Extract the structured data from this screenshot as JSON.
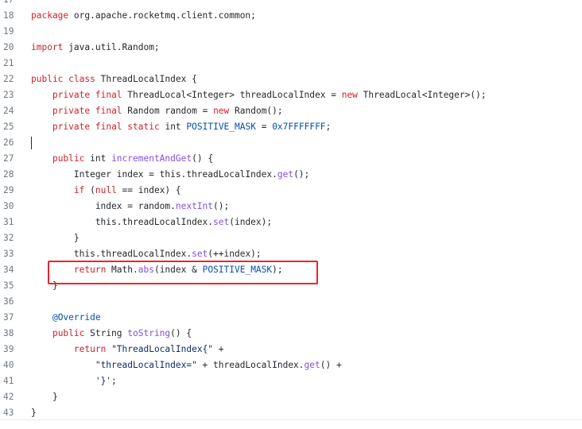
{
  "lines": [
    {
      "num": "17",
      "tokens": []
    },
    {
      "num": "18",
      "tokens": [
        {
          "c": "kw",
          "t": "package"
        },
        {
          "c": "t",
          "t": " org.apache.rocketmq.client.common;"
        }
      ]
    },
    {
      "num": "19",
      "tokens": []
    },
    {
      "num": "20",
      "tokens": [
        {
          "c": "kw",
          "t": "import"
        },
        {
          "c": "t",
          "t": " java.util.Random;"
        }
      ]
    },
    {
      "num": "21",
      "tokens": []
    },
    {
      "num": "22",
      "tokens": [
        {
          "c": "kw",
          "t": "public"
        },
        {
          "c": "t",
          "t": " "
        },
        {
          "c": "kw",
          "t": "class"
        },
        {
          "c": "t",
          "t": " ThreadLocalIndex {"
        }
      ]
    },
    {
      "num": "23",
      "tokens": [
        {
          "c": "t",
          "t": "    "
        },
        {
          "c": "kw",
          "t": "private"
        },
        {
          "c": "t",
          "t": " "
        },
        {
          "c": "kw",
          "t": "final"
        },
        {
          "c": "t",
          "t": " ThreadLocal<Integer> threadLocalIndex = "
        },
        {
          "c": "kw",
          "t": "new"
        },
        {
          "c": "t",
          "t": " ThreadLocal<Integer>();"
        }
      ]
    },
    {
      "num": "24",
      "tokens": [
        {
          "c": "t",
          "t": "    "
        },
        {
          "c": "kw",
          "t": "private"
        },
        {
          "c": "t",
          "t": " "
        },
        {
          "c": "kw",
          "t": "final"
        },
        {
          "c": "t",
          "t": " Random random = "
        },
        {
          "c": "kw",
          "t": "new"
        },
        {
          "c": "t",
          "t": " Random();"
        }
      ]
    },
    {
      "num": "25",
      "tokens": [
        {
          "c": "t",
          "t": "    "
        },
        {
          "c": "kw",
          "t": "private"
        },
        {
          "c": "t",
          "t": " "
        },
        {
          "c": "kw",
          "t": "final"
        },
        {
          "c": "t",
          "t": " "
        },
        {
          "c": "kw",
          "t": "static"
        },
        {
          "c": "t",
          "t": " int "
        },
        {
          "c": "cst",
          "t": "POSITIVE_MASK"
        },
        {
          "c": "t",
          "t": " = "
        },
        {
          "c": "cst",
          "t": "0x7FFFFFFF"
        },
        {
          "c": "t",
          "t": ";"
        }
      ]
    },
    {
      "num": "26",
      "tokens": []
    },
    {
      "num": "27",
      "tokens": [
        {
          "c": "t",
          "t": "    "
        },
        {
          "c": "kw",
          "t": "public"
        },
        {
          "c": "t",
          "t": " int "
        },
        {
          "c": "fn",
          "t": "incrementAndGet"
        },
        {
          "c": "t",
          "t": "() {"
        }
      ]
    },
    {
      "num": "28",
      "tokens": [
        {
          "c": "t",
          "t": "        Integer index = this.threadLocalIndex."
        },
        {
          "c": "fn",
          "t": "get"
        },
        {
          "c": "t",
          "t": "();"
        }
      ]
    },
    {
      "num": "29",
      "tokens": [
        {
          "c": "t",
          "t": "        "
        },
        {
          "c": "kw",
          "t": "if"
        },
        {
          "c": "t",
          "t": " ("
        },
        {
          "c": "kw",
          "t": "null"
        },
        {
          "c": "t",
          "t": " == index) {"
        }
      ]
    },
    {
      "num": "30",
      "tokens": [
        {
          "c": "t",
          "t": "            index = random."
        },
        {
          "c": "fn",
          "t": "nextInt"
        },
        {
          "c": "t",
          "t": "();"
        }
      ]
    },
    {
      "num": "31",
      "tokens": [
        {
          "c": "t",
          "t": "            this.threadLocalIndex."
        },
        {
          "c": "fn",
          "t": "set"
        },
        {
          "c": "t",
          "t": "(index);"
        }
      ]
    },
    {
      "num": "32",
      "tokens": [
        {
          "c": "t",
          "t": "        }"
        }
      ]
    },
    {
      "num": "33",
      "tokens": [
        {
          "c": "t",
          "t": "        this.threadLocalIndex."
        },
        {
          "c": "fn",
          "t": "set"
        },
        {
          "c": "t",
          "t": "(++index);"
        }
      ]
    },
    {
      "num": "34",
      "tokens": [
        {
          "c": "t",
          "t": "        "
        },
        {
          "c": "kw",
          "t": "return"
        },
        {
          "c": "t",
          "t": " Math."
        },
        {
          "c": "fn",
          "t": "abs"
        },
        {
          "c": "t",
          "t": "(index & "
        },
        {
          "c": "cst",
          "t": "POSITIVE_MASK"
        },
        {
          "c": "t",
          "t": ");"
        }
      ]
    },
    {
      "num": "35",
      "tokens": [
        {
          "c": "t",
          "t": "    }"
        }
      ]
    },
    {
      "num": "36",
      "tokens": []
    },
    {
      "num": "37",
      "tokens": [
        {
          "c": "t",
          "t": "    "
        },
        {
          "c": "ann",
          "t": "@Override"
        }
      ]
    },
    {
      "num": "38",
      "tokens": [
        {
          "c": "t",
          "t": "    "
        },
        {
          "c": "kw",
          "t": "public"
        },
        {
          "c": "t",
          "t": " String "
        },
        {
          "c": "fn",
          "t": "toString"
        },
        {
          "c": "t",
          "t": "() {"
        }
      ]
    },
    {
      "num": "39",
      "tokens": [
        {
          "c": "t",
          "t": "        "
        },
        {
          "c": "kw",
          "t": "return"
        },
        {
          "c": "t",
          "t": " "
        },
        {
          "c": "str",
          "t": "\"ThreadLocalIndex{\""
        },
        {
          "c": "t",
          "t": " +"
        }
      ]
    },
    {
      "num": "40",
      "tokens": [
        {
          "c": "t",
          "t": "            "
        },
        {
          "c": "str",
          "t": "\"threadLocalIndex=\""
        },
        {
          "c": "t",
          "t": " + threadLocalIndex."
        },
        {
          "c": "fn",
          "t": "get"
        },
        {
          "c": "t",
          "t": "() +"
        }
      ]
    },
    {
      "num": "41",
      "tokens": [
        {
          "c": "t",
          "t": "            "
        },
        {
          "c": "str",
          "t": "'}'"
        },
        {
          "c": "t",
          "t": ";"
        }
      ]
    },
    {
      "num": "42",
      "tokens": [
        {
          "c": "t",
          "t": "    }"
        }
      ]
    },
    {
      "num": "43",
      "tokens": [
        {
          "c": "t",
          "t": "}"
        }
      ]
    }
  ],
  "highlight": {
    "line": "34",
    "color": "#e8262b"
  },
  "colors": {
    "keyword": "#cf222e",
    "function": "#8250df",
    "constant": "#0550ae",
    "string": "#0a3069",
    "text": "#24292e",
    "gutter": "#6e7781"
  }
}
